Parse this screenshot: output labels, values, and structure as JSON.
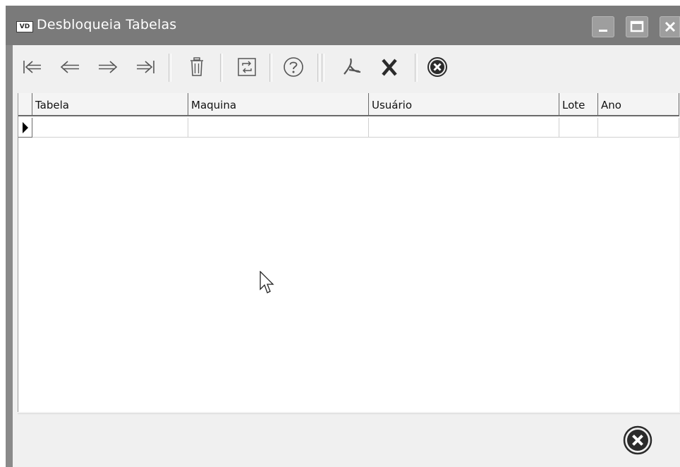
{
  "window": {
    "title": "Desbloqueia Tabelas",
    "app_icon_text": "VD"
  },
  "toolbar": {
    "buttons": [
      {
        "name": "first-record",
        "icon": "first-icon"
      },
      {
        "name": "prior-record",
        "icon": "prior-icon"
      },
      {
        "name": "next-record",
        "icon": "next-icon"
      },
      {
        "name": "last-record",
        "icon": "last-icon"
      },
      {
        "name": "delete",
        "icon": "trash-icon"
      },
      {
        "name": "refresh",
        "icon": "refresh-icon"
      },
      {
        "name": "help",
        "icon": "help-icon"
      },
      {
        "name": "export-pdf",
        "icon": "pdf-icon"
      },
      {
        "name": "export-excel",
        "icon": "excel-icon"
      },
      {
        "name": "close",
        "icon": "close-circle-icon"
      }
    ]
  },
  "grid": {
    "columns": [
      "Tabela",
      "Maquina",
      "Usuário",
      "Lote",
      "Ano"
    ],
    "rows": [
      [
        "",
        "",
        "",
        "",
        ""
      ]
    ]
  },
  "colors": {
    "titlebar": "#7a7a7a",
    "window_bg": "#f0f0f0"
  }
}
